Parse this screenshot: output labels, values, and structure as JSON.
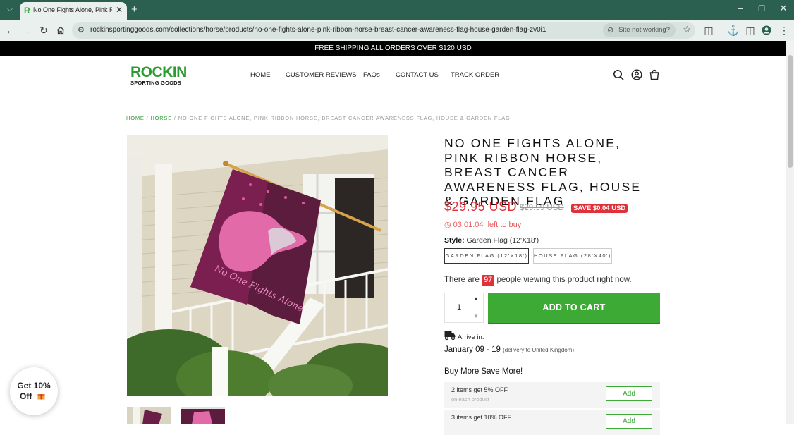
{
  "browser": {
    "tab_title": "No One Fights Alone, Pink Ribbon Horse",
    "url": "rockinsportinggoods.com/collections/horse/products/no-one-fights-alone-pink-ribbon-horse-breast-cancer-awareness-flag-house-garden-flag-zv0i1",
    "site_not_working": "Site not working?",
    "favicon_letter": "R",
    "icons": [
      "tab-list-icon",
      "close-icon",
      "new-tab-icon",
      "minimize-icon",
      "restore-icon",
      "window-close-icon",
      "back-icon",
      "forward-icon",
      "reload-icon",
      "home-icon",
      "site-info-icon",
      "eye-off-icon",
      "star-icon",
      "extensions-icon",
      "labs-icon",
      "sidepanel-icon",
      "profile-icon",
      "menu-icon"
    ]
  },
  "store": {
    "promo": "FREE SHIPPING ALL ORDERS OVER $120 USD",
    "logo_main": "ROCKIN",
    "logo_sub": "SPORTING GOODS",
    "menu": [
      "HOME",
      "CUSTOMER REVIEWS",
      "FAQs",
      "CONTACT US",
      "TRACK ORDER"
    ],
    "brand_color": "#2d9b32"
  },
  "breadcrumb": {
    "home": "HOME",
    "sep1": " / ",
    "collection": "HORSE",
    "sep2": " / ",
    "current": "NO ONE FIGHTS ALONE, PINK RIBBON HORSE, BREAST CANCER AWARENESS FLAG, HOUSE & GARDEN FLAG"
  },
  "product": {
    "title": "NO ONE FIGHTS ALONE, PINK RIBBON HORSE, BREAST CANCER AWARENESS FLAG, HOUSE & GARDEN FLAG",
    "price": "$29.95 USD",
    "compare_price": "$29.99 USD",
    "save_badge": "SAVE $0.04 USD",
    "timer": "03:01:04",
    "timer_suffix": "left to buy",
    "style_label": "Style:",
    "style_value": "Garden Flag (12'X18')",
    "options": [
      "GARDEN FLAG (12'X18')",
      "HOUSE FLAG (28'X40')"
    ],
    "viewing_prefix": "There are",
    "viewing_count": "97",
    "viewing_suffix": "people viewing this product right now.",
    "quantity": "1",
    "add_to_cart": "ADD TO CART",
    "arrive_label": "Arrive in:",
    "arrive_dates": "January 09 - 19",
    "arrive_note": "(delivery to United Kingdom)",
    "image_text": "No One Fights Alone",
    "price_color": "#e0303a",
    "cart_color": "#3daa36"
  },
  "bundles": {
    "title": "Buy More Save More!",
    "items": [
      {
        "name": "2 items get 5% OFF",
        "sub": "on each product",
        "button": "Add"
      },
      {
        "name": "3 items get 10% OFF",
        "sub": "",
        "button": "Add"
      }
    ]
  },
  "popup": {
    "line1": "Get 10%",
    "line2": "Off"
  }
}
